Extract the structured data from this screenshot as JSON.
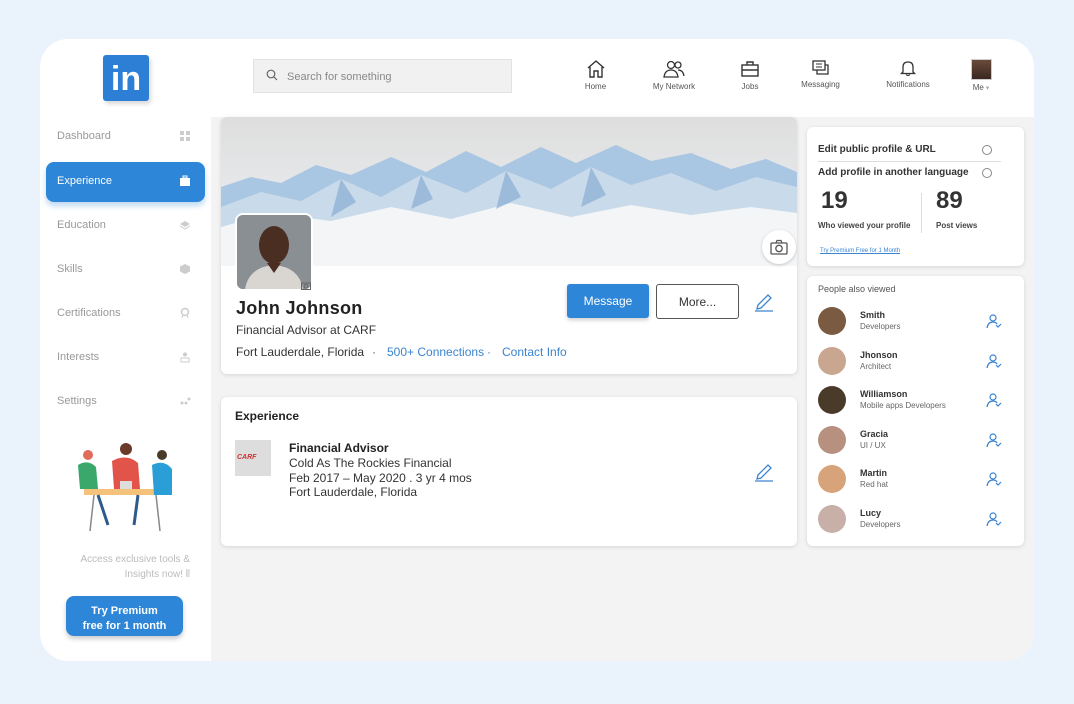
{
  "brand": {
    "logo_text": "in"
  },
  "search": {
    "placeholder": "Search for something"
  },
  "nav": [
    {
      "label": "Home",
      "icon": "home-icon"
    },
    {
      "label": "My Network",
      "icon": "network-icon"
    },
    {
      "label": "Jobs",
      "icon": "briefcase-icon"
    },
    {
      "label": "Messaging",
      "icon": "messaging-icon"
    },
    {
      "label": "Notifications",
      "icon": "bell-icon"
    },
    {
      "label": "Me",
      "icon": "avatar"
    }
  ],
  "sidebar": {
    "items": [
      {
        "label": "Dashboard",
        "icon": "grid-icon"
      },
      {
        "label": "Experience",
        "icon": "briefcase-icon",
        "active": true
      },
      {
        "label": "Education",
        "icon": "book-icon"
      },
      {
        "label": "Skills",
        "icon": "cube-icon"
      },
      {
        "label": "Certifications",
        "icon": "badge-icon"
      },
      {
        "label": "Interests",
        "icon": "people-icon"
      },
      {
        "label": "Settings",
        "icon": "dots-icon"
      }
    ],
    "promo_line1": "Access exclusive tools &",
    "promo_line2": "Insights now!",
    "premium_line1": "Try Premium",
    "premium_line2": "free for 1 month"
  },
  "profile": {
    "name": "John Johnson",
    "headline": "Financial Advisor at CARF",
    "location": "Fort Lauderdale, Florida",
    "connections": "500+ Connections",
    "contact": "Contact Info",
    "message_label": "Message",
    "more_label": "More..."
  },
  "experience": {
    "title": "Experience",
    "logo_text": "CARF",
    "role": "Financial Advisor",
    "company": "Cold As The Rockies Financial",
    "dates": "Feb 2017 – May 2020  .  3 yr 4 mos",
    "location": "Fort Lauderdale, Florida"
  },
  "right": {
    "edit_profile": "Edit public profile & URL",
    "add_language": "Add profile in another language",
    "viewed_count": "19",
    "viewed_label": "Who viewed your profile",
    "post_views": "89",
    "post_views_label": "Post views",
    "premium_link": "Try Premium Free for 1 Month"
  },
  "people": {
    "title": "People also viewed",
    "list": [
      {
        "name": "Smith",
        "role": "Developers",
        "color": "#7a5a40"
      },
      {
        "name": "Jhonson",
        "role": "Architect",
        "color": "#c9a690"
      },
      {
        "name": "Williamson",
        "role": " Mobile apps Developers",
        "color": "#4a3a2a"
      },
      {
        "name": "Gracia",
        "role": "UI / UX",
        "color": "#b89080"
      },
      {
        "name": "Martin",
        "role": "Red hat",
        "color": "#d7a37a"
      },
      {
        "name": "Lucy",
        "role": "Developers",
        "color": "#c8b0a8"
      }
    ]
  },
  "colors": {
    "accent": "#2d86d8",
    "link": "#3a84d0"
  }
}
